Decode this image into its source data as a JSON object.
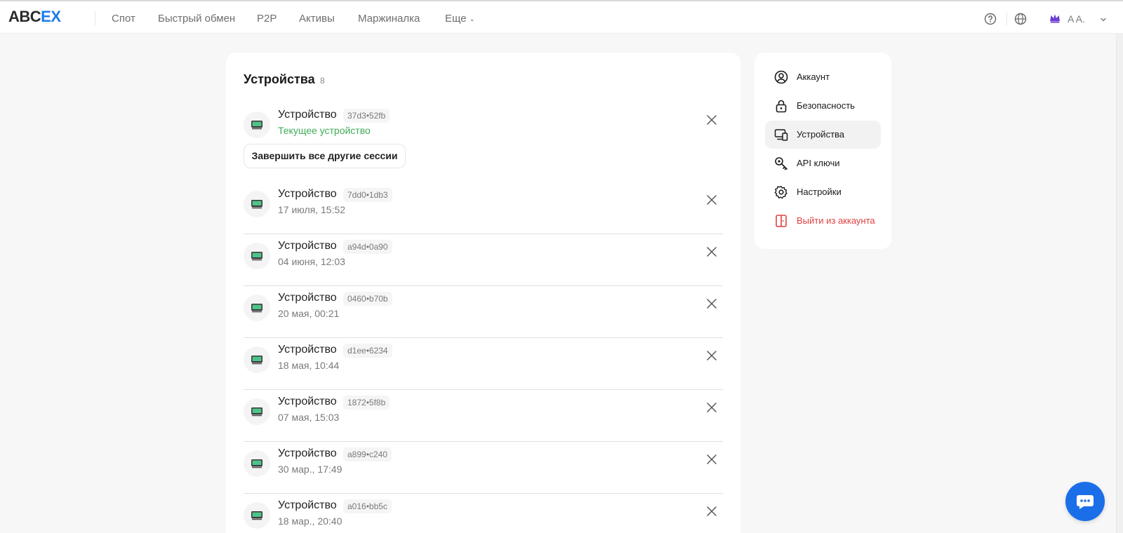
{
  "header": {
    "logo_abc": "ABC",
    "logo_ex": "EX",
    "nav": [
      "Спот",
      "Быстрый обмен",
      "P2P",
      "Активы",
      "Маржиналка",
      "Еще"
    ],
    "user_name": "A A."
  },
  "main": {
    "title": "Устройства",
    "count": "8",
    "end_sessions_label": "Завершить все другие сессии",
    "devices": [
      {
        "name": "Устройство",
        "id": "37d3•52fb",
        "sub": "Текущее устройство"
      },
      {
        "name": "Устройство",
        "id": "7dd0•1db3",
        "sub": "17 июля, 15:52"
      },
      {
        "name": "Устройство",
        "id": "a94d•0a90",
        "sub": "04 июня, 12:03"
      },
      {
        "name": "Устройство",
        "id": "0460•b70b",
        "sub": "20 мая, 00:21"
      },
      {
        "name": "Устройство",
        "id": "d1ee•6234",
        "sub": "18 мая, 10:44"
      },
      {
        "name": "Устройство",
        "id": "1872•5f8b",
        "sub": "07 мая, 15:03"
      },
      {
        "name": "Устройство",
        "id": "a899•c240",
        "sub": "30 мар., 17:49"
      },
      {
        "name": "Устройство",
        "id": "a016•bb5c",
        "sub": "18 мар., 20:40"
      }
    ]
  },
  "sidebar": {
    "items": [
      {
        "label": "Аккаунт",
        "icon": "user-circle-icon"
      },
      {
        "label": "Безопасность",
        "icon": "lock-icon"
      },
      {
        "label": "Устройства",
        "icon": "devices-icon"
      },
      {
        "label": "API ключи",
        "icon": "key-icon"
      },
      {
        "label": "Настройки",
        "icon": "gear-icon"
      },
      {
        "label": "Выйти из аккаунта",
        "icon": "logout-icon"
      }
    ]
  },
  "colors": {
    "brand_blue": "#1a7cf0",
    "current_green": "#3fae5a",
    "danger_red": "#e04040",
    "chat_blue": "#1a6fe8"
  }
}
